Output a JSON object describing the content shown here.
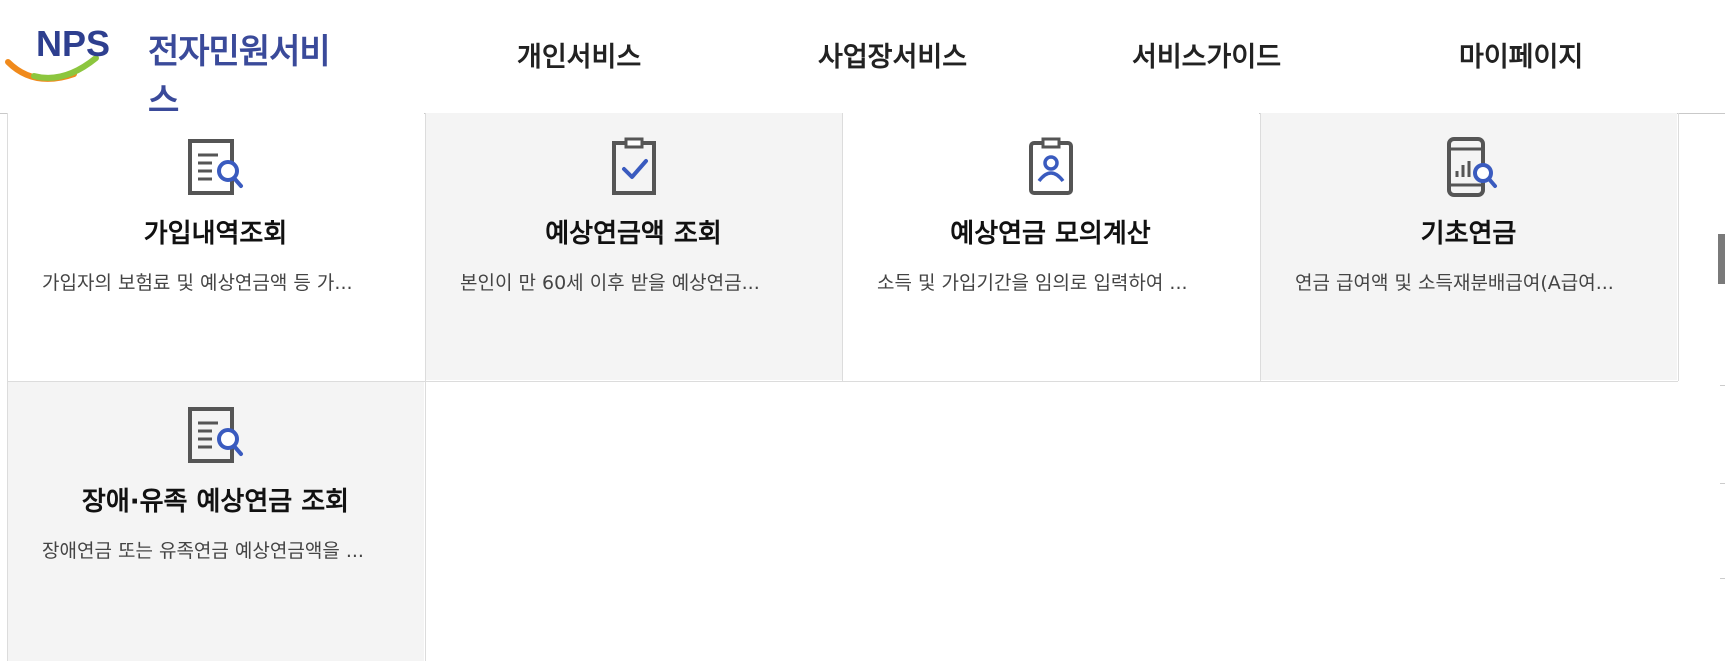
{
  "header": {
    "logo_mark_text": "NPS",
    "logo_text": "전자민원서비스",
    "nav": [
      "개인서비스",
      "사업장서비스",
      "서비스가이드",
      "마이페이지"
    ]
  },
  "cards": [
    {
      "title": "가입내역조회",
      "desc": "가입자의 보험료 및 예상연금액 등 가...",
      "icon": "document-search-icon"
    },
    {
      "title": "예상연금액 조회",
      "desc": "본인이 만 60세 이후 받을 예상연금...",
      "icon": "clipboard-check-icon"
    },
    {
      "title": "예상연금 모의계산",
      "desc": "소득 및 가입기간을 임의로 입력하여 ...",
      "icon": "id-badge-icon"
    },
    {
      "title": "기초연금",
      "desc": "연금 급여액 및 소득재분배급여(A급여...",
      "icon": "mobile-chart-search-icon"
    },
    {
      "title": "장애·유족 예상연금 조회",
      "desc": "장애연금 또는 유족연금 예상연금액을 ...",
      "icon": "document-search-icon"
    }
  ]
}
